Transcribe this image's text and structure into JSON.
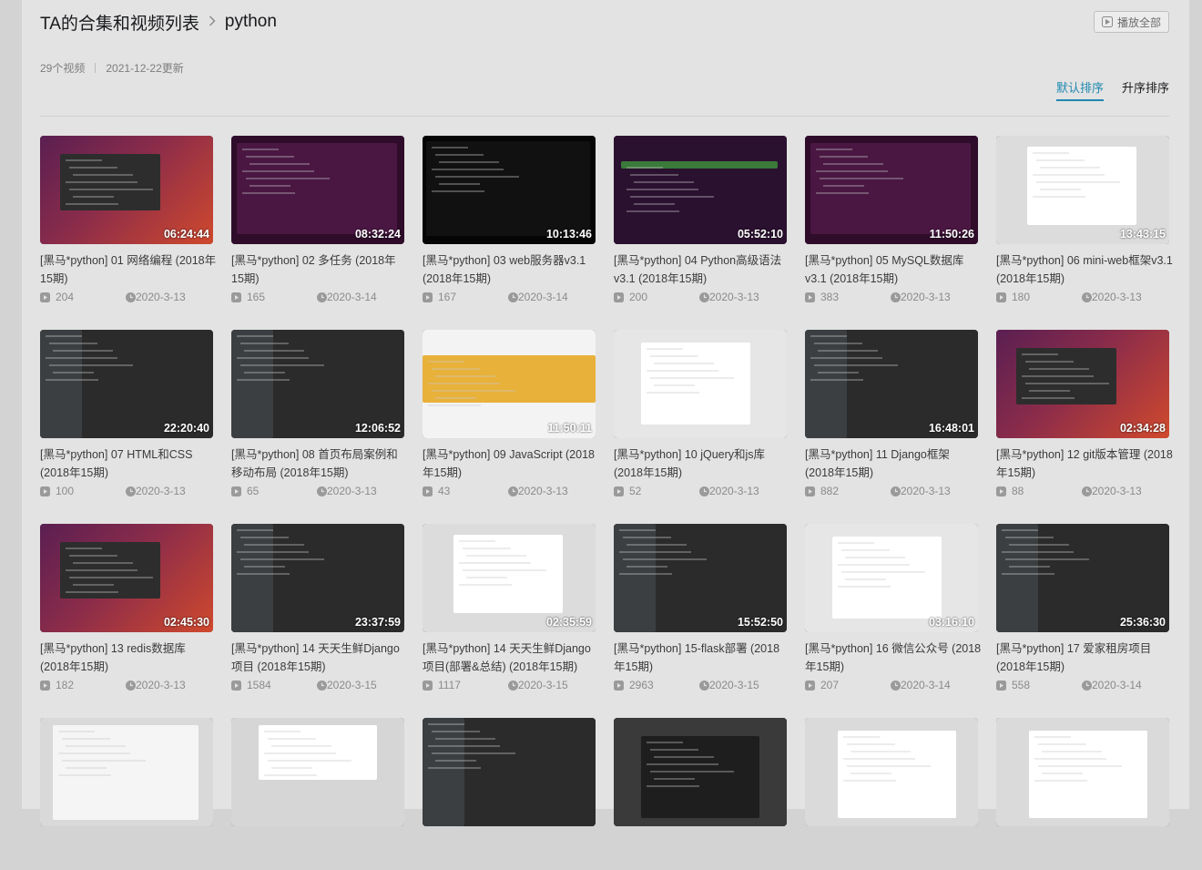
{
  "breadcrumb": {
    "parent": "TA的合集和视频列表",
    "sep": ">",
    "current": "python"
  },
  "meta": {
    "count": "29个视频",
    "updated": "2021-12-22更新"
  },
  "play_all": "播放全部",
  "sort": {
    "default": "默认排序",
    "asc": "升序排序"
  },
  "colors": {
    "accent": "#1e88b0"
  },
  "videos": [
    {
      "title": "[黑马*python] 01 网络编程 (2018年15期)",
      "duration": "06:24:44",
      "plays": "204",
      "date": "2020-3-13",
      "theme": "ubuntu"
    },
    {
      "title": "[黑马*python] 02 多任务 (2018年15期)",
      "duration": "08:32:24",
      "plays": "165",
      "date": "2020-3-14",
      "theme": "terminal-purple"
    },
    {
      "title": "[黑马*python] 03 web服务器v3.1 (2018年15期)",
      "duration": "10:13:46",
      "plays": "167",
      "date": "2020-3-14",
      "theme": "terminal-black"
    },
    {
      "title": "[黑马*python] 04 Python高级语法v3.1 (2018年15期)",
      "duration": "05:52:10",
      "plays": "200",
      "date": "2020-3-13",
      "theme": "terminal-green"
    },
    {
      "title": "[黑马*python] 05 MySQL数据库v3.1 (2018年15期)",
      "duration": "11:50:26",
      "plays": "383",
      "date": "2020-3-13",
      "theme": "terminal-purple"
    },
    {
      "title": "[黑马*python] 06 mini-web框架v3.1 (2018年15期)",
      "duration": "13:43:15",
      "plays": "180",
      "date": "2020-3-13",
      "theme": "slides"
    },
    {
      "title": "[黑马*python] 07 HTML和CSS (2018年15期)",
      "duration": "22:20:40",
      "plays": "100",
      "date": "2020-3-13",
      "theme": "ide-dark"
    },
    {
      "title": "[黑马*python] 08 首页布局案例和移动布局 (2018年15期)",
      "duration": "12:06:52",
      "plays": "65",
      "date": "2020-3-13",
      "theme": "ide-dark"
    },
    {
      "title": "[黑马*python] 09 JavaScript (2018年15期)",
      "duration": "11:50:11",
      "plays": "43",
      "date": "2020-3-13",
      "theme": "webpage"
    },
    {
      "title": "[黑马*python] 10 jQuery和js库 (2018年15期)",
      "duration": "",
      "plays": "52",
      "date": "2020-3-13",
      "theme": "grey-doc"
    },
    {
      "title": "[黑马*python] 11 Django框架 (2018年15期)",
      "duration": "16:48:01",
      "plays": "882",
      "date": "2020-3-13",
      "theme": "ide-dark"
    },
    {
      "title": "[黑马*python] 12 git版本管理 (2018年15期)",
      "duration": "02:34:28",
      "plays": "88",
      "date": "2020-3-13",
      "theme": "ubuntu"
    },
    {
      "title": "[黑马*python] 13 redis数据库 (2018年15期)",
      "duration": "02:45:30",
      "plays": "182",
      "date": "2020-3-13",
      "theme": "ubuntu"
    },
    {
      "title": "[黑马*python] 14 天天生鲜Django项目 (2018年15期)",
      "duration": "23:37:59",
      "plays": "1584",
      "date": "2020-3-15",
      "theme": "ide-dark"
    },
    {
      "title": "[黑马*python] 14 天天生鲜Django项目(部署&总结) (2018年15期)",
      "duration": "02:35:59",
      "plays": "1117",
      "date": "2020-3-15",
      "theme": "slides"
    },
    {
      "title": "[黑马*python] 15-flask部署 (2018年15期)",
      "duration": "15:52:50",
      "plays": "2963",
      "date": "2020-3-15",
      "theme": "ide-dark"
    },
    {
      "title": "[黑马*python] 16 微信公众号 (2018年15期)",
      "duration": "03:16:10",
      "plays": "207",
      "date": "2020-3-14",
      "theme": "grey-doc"
    },
    {
      "title": "[黑马*python] 17 爱家租房项目 (2018年15期)",
      "duration": "25:36:30",
      "plays": "558",
      "date": "2020-3-14",
      "theme": "ide-dark"
    },
    {
      "title": "",
      "duration": "",
      "plays": "",
      "date": "",
      "theme": "finder"
    },
    {
      "title": "",
      "duration": "",
      "plays": "",
      "date": "",
      "theme": "dock"
    },
    {
      "title": "",
      "duration": "",
      "plays": "",
      "date": "",
      "theme": "ide-dark"
    },
    {
      "title": "",
      "duration": "",
      "plays": "",
      "date": "",
      "theme": "office"
    },
    {
      "title": "",
      "duration": "",
      "plays": "",
      "date": "",
      "theme": "ppt"
    },
    {
      "title": "",
      "duration": "",
      "plays": "",
      "date": "",
      "theme": "ppt"
    }
  ]
}
